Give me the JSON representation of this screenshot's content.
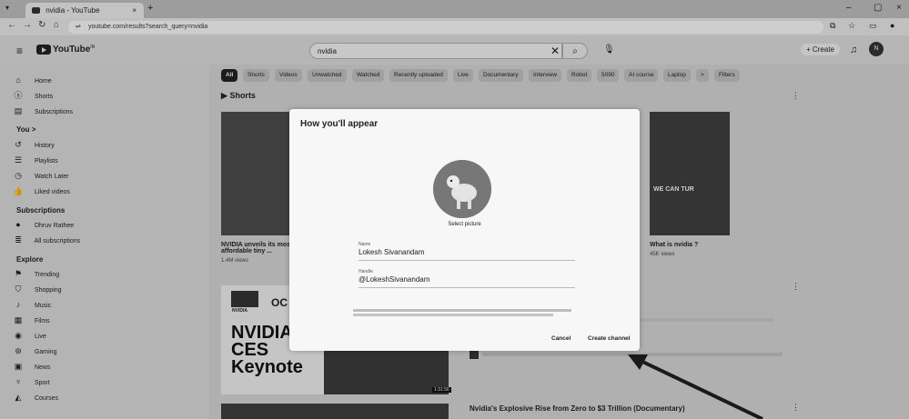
{
  "browser": {
    "tab_title": "nvidia - YouTube",
    "tab_close": "×",
    "new_tab": "+",
    "url": "youtube.com/results?search_query=nvidia"
  },
  "header": {
    "logo_text": "YouTube",
    "logo_sup": "IN",
    "search_value": "nvidia",
    "create_label": "+ Create",
    "avatar_letter": "N"
  },
  "sidebar": {
    "top_items": [
      {
        "label": "Home",
        "icon": "home-icon"
      },
      {
        "label": "Shorts",
        "icon": "shorts-icon"
      },
      {
        "label": "Subscriptions",
        "icon": "subscriptions-icon"
      }
    ],
    "you_heading": "You >",
    "you_items": [
      {
        "label": "History",
        "icon": "history-icon"
      },
      {
        "label": "Playlists",
        "icon": "playlists-icon"
      },
      {
        "label": "Watch Later",
        "icon": "watch-later-icon"
      },
      {
        "label": "Liked videos",
        "icon": "like-icon"
      }
    ],
    "subs_heading": "Subscriptions",
    "subs_items": [
      {
        "label": "Dhruv Rathee",
        "icon": "channel-avatar-icon"
      },
      {
        "label": "All subscriptions",
        "icon": "list-icon"
      }
    ],
    "explore_heading": "Explore",
    "explore_items": [
      {
        "label": "Trending",
        "icon": "trending-icon"
      },
      {
        "label": "Shopping",
        "icon": "shopping-icon"
      },
      {
        "label": "Music",
        "icon": "music-icon"
      },
      {
        "label": "Films",
        "icon": "film-icon"
      },
      {
        "label": "Live",
        "icon": "live-icon"
      },
      {
        "label": "Gaming",
        "icon": "gaming-icon"
      },
      {
        "label": "News",
        "icon": "news-icon"
      },
      {
        "label": "Sport",
        "icon": "sport-icon"
      },
      {
        "label": "Courses",
        "icon": "courses-icon"
      }
    ]
  },
  "chips": [
    "All",
    "Shorts",
    "Videos",
    "Unwatched",
    "Watched",
    "Recently uploaded",
    "Live",
    "Documentary",
    "Interview",
    "Robot",
    "5090",
    "AI course",
    "Laptop",
    ">",
    "Filters"
  ],
  "shorts": {
    "title": "Shorts",
    "items": [
      {
        "title": "NVIDIA unveils its most affordable tiny ...",
        "meta": "1.4M views"
      },
      {
        "title": "What is nvidia ?",
        "meta": "45K views"
      }
    ],
    "thumb_overlay": "WE CAN TUR"
  },
  "videos": {
    "keynote_lines": [
      "NVIDIA",
      "CES",
      "Keynote"
    ],
    "brand": "NVIDIA",
    "brand_partial": "OC",
    "duration": "1:31:56",
    "second_title": "Nvidia's Explosive Rise from Zero to $3 Trillion (Documentary)"
  },
  "dialog": {
    "title": "How you'll appear",
    "select_picture": "Select picture",
    "name_label": "Name",
    "name_value": "Lokesh Sivanandam",
    "handle_label": "Handle",
    "handle_value": "@LokeshSivanandam",
    "cancel_label": "Cancel",
    "create_label": "Create channel"
  },
  "colors": {
    "dialog_bg": "#f7f7f7",
    "chip_active": "#222222",
    "annotation_arrow": "#1a1a1a"
  }
}
